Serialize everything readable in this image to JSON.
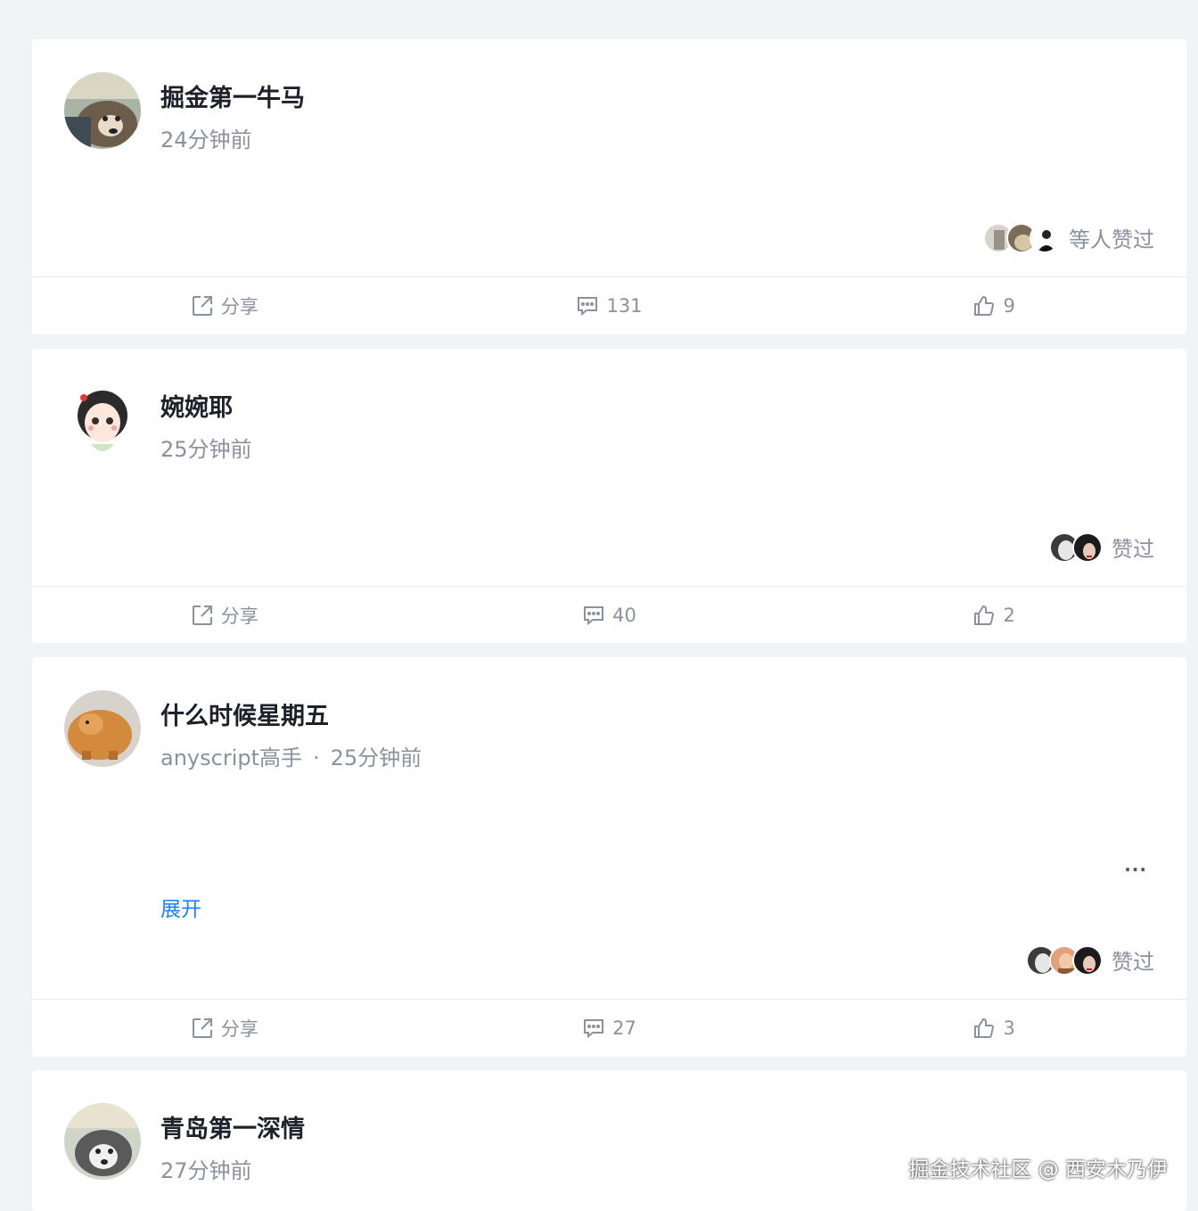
{
  "posts": [
    {
      "author": "掘金第一牛马",
      "meta": "24分钟前",
      "likers_text": "等人赞过",
      "share_label": "分享",
      "comment_count": "131",
      "like_count": "9"
    },
    {
      "author": "婉婉耶",
      "meta": "25分钟前",
      "likers_text": "赞过",
      "share_label": "分享",
      "comment_count": "40",
      "like_count": "2"
    },
    {
      "author": "什么时候星期五",
      "title_tag": "anyscript高手",
      "separator": "·",
      "meta": "25分钟前",
      "expand_label": "展开",
      "more_label": "···",
      "likers_text": "赞过",
      "share_label": "分享",
      "comment_count": "27",
      "like_count": "3"
    },
    {
      "author": "青岛第一深情",
      "meta": "27分钟前"
    }
  ],
  "watermark": "掘金技术社区 @ 西安木乃伊",
  "colors": {
    "link": "#1e80ff",
    "muted": "#8a919f",
    "text": "#1d2129",
    "background": "#f2f3f5"
  }
}
